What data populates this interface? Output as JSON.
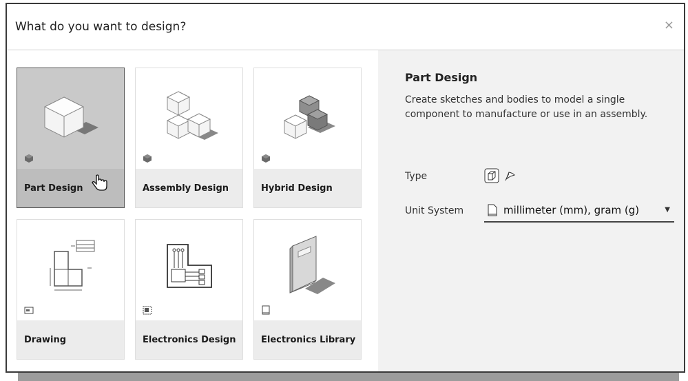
{
  "dialog": {
    "title": "What do you want to design?",
    "close_symbol": "×"
  },
  "tiles": [
    {
      "label": "Part Design",
      "selected": true,
      "icon": "cube-icon"
    },
    {
      "label": "Assembly Design",
      "selected": false,
      "icon": "assembly-cubes-icon"
    },
    {
      "label": "Hybrid Design",
      "selected": false,
      "icon": "hybrid-cubes-icon"
    },
    {
      "label": "Drawing",
      "selected": false,
      "icon": "drawing-icon"
    },
    {
      "label": "Electronics Design",
      "selected": false,
      "icon": "circuit-board-icon"
    },
    {
      "label": "Electronics Library",
      "selected": false,
      "icon": "book-icon"
    }
  ],
  "details": {
    "title": "Part Design",
    "description": "Create sketches and bodies to model a single component to manufacture or use in an assembly.",
    "type_label": "Type",
    "type_icons": [
      "solid-part-icon",
      "freeform-icon"
    ],
    "unit_label": "Unit System",
    "unit_value": "millimeter (mm), gram (g)"
  },
  "colors": {
    "selected_tile": "#c9c9c9",
    "panel_bg": "#f2f2f2"
  }
}
